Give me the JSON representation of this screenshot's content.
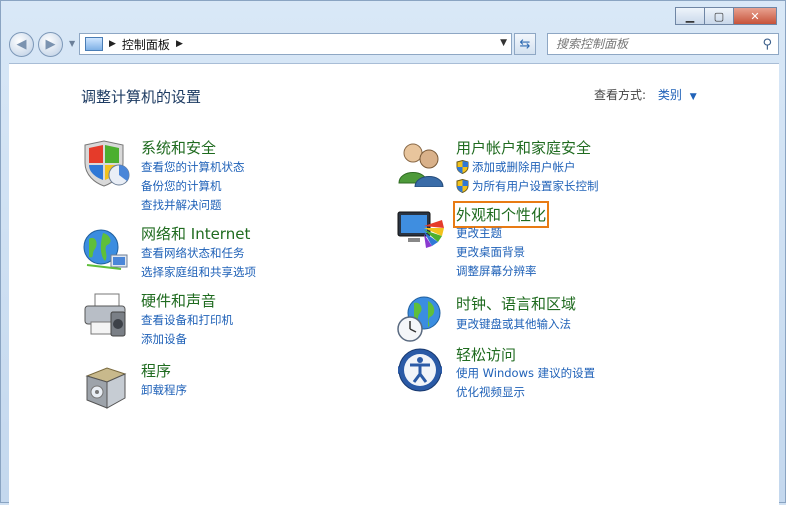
{
  "address": {
    "crumb": "控制面板"
  },
  "search": {
    "placeholder": "搜索控制面板"
  },
  "heading": "调整计算机的设置",
  "viewby": {
    "label": "查看方式:",
    "value": "类别"
  },
  "categories": [
    {
      "title": "系统和安全",
      "links": [
        "查看您的计算机状态",
        "备份您的计算机",
        "查找并解决问题"
      ]
    },
    {
      "title": "网络和 Internet",
      "links": [
        "查看网络状态和任务",
        "选择家庭组和共享选项"
      ]
    },
    {
      "title": "硬件和声音",
      "links": [
        "查看设备和打印机",
        "添加设备"
      ]
    },
    {
      "title": "程序",
      "links": [
        "卸载程序"
      ]
    },
    {
      "title": "用户帐户和家庭安全",
      "links": [
        "添加或删除用户帐户",
        "为所有用户设置家长控制"
      ]
    },
    {
      "title": "外观和个性化",
      "links": [
        "更改主题",
        "更改桌面背景",
        "调整屏幕分辨率"
      ]
    },
    {
      "title": "时钟、语言和区域",
      "links": [
        "更改键盘或其他输入法"
      ]
    },
    {
      "title": "轻松访问",
      "links": [
        "使用 Windows 建议的设置",
        "优化视频显示"
      ]
    }
  ]
}
